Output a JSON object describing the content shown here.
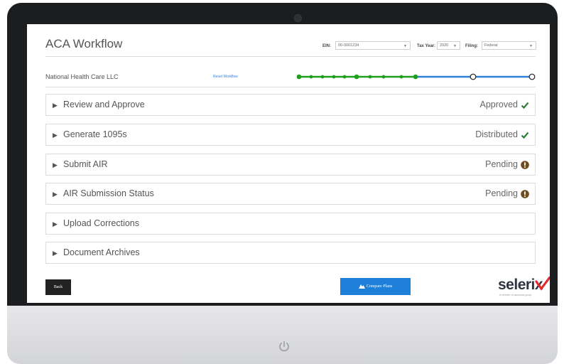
{
  "header": {
    "title": "ACA Workflow",
    "ein_label": "EIN:",
    "ein_value": "00-0001234",
    "tax_year_label": "Tax Year:",
    "tax_year_value": "2020",
    "filing_label": "Filing:",
    "filing_value": "Federal"
  },
  "company": {
    "name": "National Health Care LLC",
    "reset_label": "Reset Workflow"
  },
  "progress": {
    "completed_color": "#1ea01e",
    "remaining_color": "#2f7fd8",
    "completed_fraction": 0.52
  },
  "sections": [
    {
      "title": "Review and Approve",
      "status": "Approved",
      "status_icon": "check-icon"
    },
    {
      "title": "Generate 1095s",
      "status": "Distributed",
      "status_icon": "check-icon"
    },
    {
      "title": "Submit AIR",
      "status": "Pending",
      "status_icon": "alert-icon"
    },
    {
      "title": "AIR Submission Status",
      "status": "Pending",
      "status_icon": "alert-icon"
    },
    {
      "title": "Upload Corrections",
      "status": "",
      "status_icon": ""
    },
    {
      "title": "Document Archives",
      "status": "",
      "status_icon": ""
    }
  ],
  "footer": {
    "back_label": "Back",
    "compare_label": "Compare Plans",
    "logo_text": "selerix",
    "logo_tagline": "a member of ascensus group"
  },
  "colors": {
    "check": "#2e7d32",
    "alert": "#6d4c1d",
    "brand_red": "#e32b2b",
    "button_blue": "#1e7fd8"
  }
}
